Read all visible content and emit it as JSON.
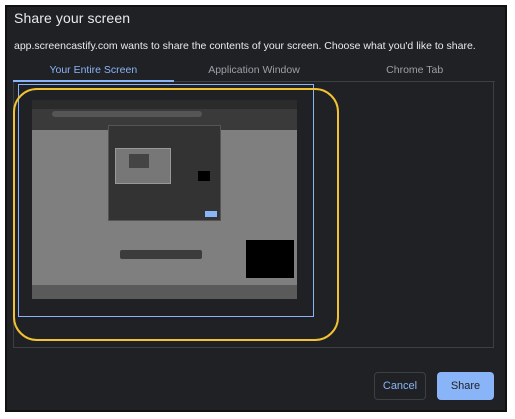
{
  "dialog": {
    "title": "Share your screen",
    "subtitle": "app.screencastify.com wants to share the contents of your screen. Choose what you'd like to share."
  },
  "tabs": [
    {
      "label": "Your Entire Screen",
      "active": true
    },
    {
      "label": "Application Window",
      "active": false
    },
    {
      "label": "Chrome Tab",
      "active": false
    }
  ],
  "buttons": {
    "cancel_label": "Cancel",
    "share_label": "Share"
  },
  "colors": {
    "background": "#202124",
    "accent": "#8ab4f8",
    "highlight": "#f1c232"
  }
}
